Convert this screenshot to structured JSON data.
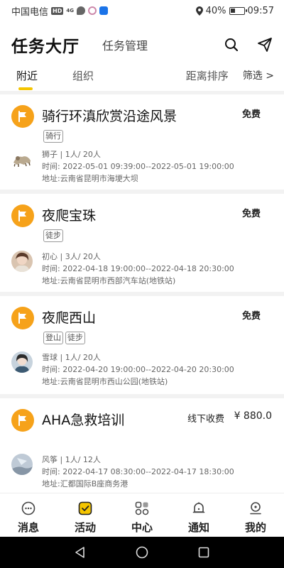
{
  "status_bar": {
    "carrier": "中国电信",
    "hd_badge": "HD",
    "network": "4G",
    "battery_percent": "40%",
    "battery_level": 0.4,
    "time": "09:57"
  },
  "header": {
    "title": "任务大厅",
    "subtitle": "任务管理",
    "search_icon": "search-icon",
    "send_icon": "send-icon"
  },
  "tabs": {
    "nearby": "附近",
    "organization": "组织",
    "sort": "距离排序",
    "filter": "筛选 >"
  },
  "tasks": [
    {
      "title": "骑行环滇欣赏沿途风景",
      "price": "免费",
      "tags": [
        "骑行"
      ],
      "organizer_line": "狮子 | 1人/ 20人",
      "time_line": "时间:  2022-05-01 09:39:00--2022-05-01 19:00:00",
      "address_line": "地址:云南省昆明市海埂大坝"
    },
    {
      "title": "夜爬宝珠",
      "price": "免费",
      "tags": [
        "徒步"
      ],
      "organizer_line": "初心 | 3人/ 20人",
      "time_line": "时间:  2022-04-18 19:00:00--2022-04-18 20:30:00",
      "address_line": "地址:云南省昆明市西部汽车站(地铁站)"
    },
    {
      "title": "夜爬西山",
      "price": "免费",
      "tags": [
        "登山",
        "徒步"
      ],
      "organizer_line": "雪球 | 1人/ 20人",
      "time_line": "时间:  2022-04-20 19:00:00--2022-04-20 20:30:00",
      "address_line": "地址:云南省昆明市西山公园(地铁站)"
    },
    {
      "title": "AHA急救培训",
      "mode": "线下收费",
      "price": "¥ 880.0",
      "tags": [],
      "organizer_line": "风筝 | 1人/ 12人",
      "time_line": "时间:  2022-04-17 08:30:00--2022-04-17 18:30:00",
      "address_line": "地址:汇都国际B座商务港"
    }
  ],
  "bottom_nav": [
    {
      "label": "消息",
      "icon": "message-icon"
    },
    {
      "label": "活动",
      "icon": "activity-icon"
    },
    {
      "label": "中心",
      "icon": "center-icon"
    },
    {
      "label": "通知",
      "icon": "bell-icon"
    },
    {
      "label": "我的",
      "icon": "profile-icon"
    }
  ],
  "colors": {
    "accent": "#f5c500",
    "flag": "#f6a21a"
  }
}
